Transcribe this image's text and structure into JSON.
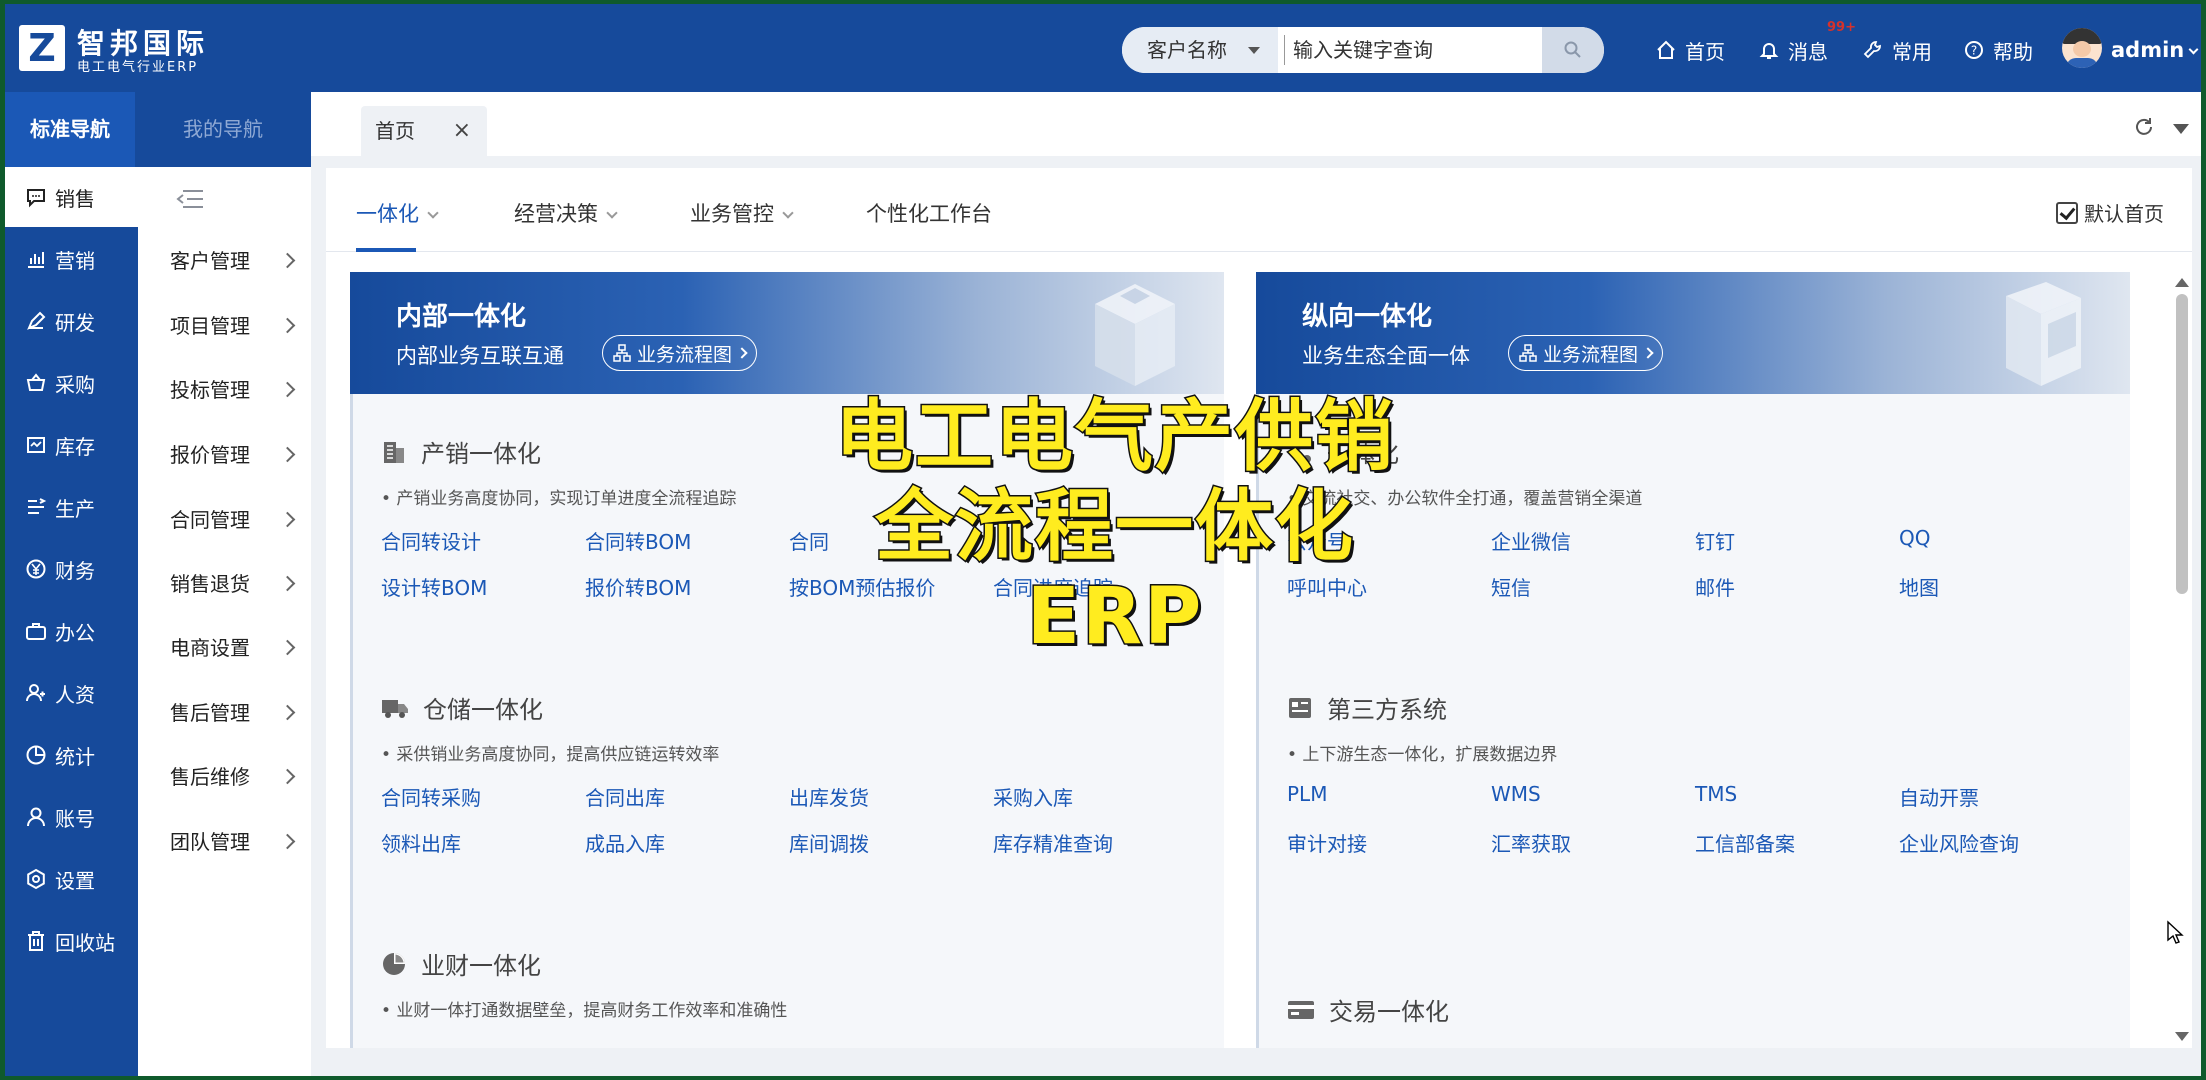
{
  "brand": {
    "name": "智邦国际",
    "subtitle": "电工电气行业ERP",
    "logo_letter": "Z"
  },
  "search": {
    "type": "客户名称",
    "placeholder": "输入关键字查询"
  },
  "topnav": {
    "home": "首页",
    "messages": "消息",
    "badge": "99+",
    "common": "常用",
    "help": "帮助",
    "user": "admin"
  },
  "nav_tabs": {
    "standard": "标准导航",
    "mine": "我的导航"
  },
  "leftnav": [
    {
      "label": "销售",
      "icon": "chat-icon"
    },
    {
      "label": "营销",
      "icon": "chart-icon"
    },
    {
      "label": "研发",
      "icon": "pen-icon"
    },
    {
      "label": "采购",
      "icon": "basket-icon"
    },
    {
      "label": "库存",
      "icon": "inventory-icon"
    },
    {
      "label": "生产",
      "icon": "production-icon"
    },
    {
      "label": "财务",
      "icon": "yen-icon"
    },
    {
      "label": "办公",
      "icon": "briefcase-icon"
    },
    {
      "label": "人资",
      "icon": "people-icon"
    },
    {
      "label": "统计",
      "icon": "pie-icon"
    },
    {
      "label": "账号",
      "icon": "user-icon"
    },
    {
      "label": "设置",
      "icon": "gear-icon"
    },
    {
      "label": "回收站",
      "icon": "trash-icon"
    }
  ],
  "submenu": [
    "客户管理",
    "项目管理",
    "投标管理",
    "报价管理",
    "合同管理",
    "销售退货",
    "电商设置",
    "售后管理",
    "售后维修",
    "团队管理"
  ],
  "doc_tab": {
    "label": "首页",
    "close": "×"
  },
  "section_tabs": [
    "一体化",
    "经营决策",
    "业务管控",
    "个性化工作台"
  ],
  "default_home": "默认首页",
  "cards": {
    "left": {
      "title": "内部一体化",
      "subtitle": "内部业务互联互通",
      "flow": "业务流程图",
      "groups": [
        {
          "title": "产销一体化",
          "desc": "• 产销业务高度协同，实现订单进度全流程追踪",
          "links": [
            "合同转设计",
            "合同转BOM",
            "合同",
            "设计转BOM",
            "报价转BOM",
            "按BOM预估报价",
            "合同进度追踪"
          ]
        },
        {
          "title": "仓储一体化",
          "desc": "• 采供销业务高度协同，提高供应链运转效率",
          "links": [
            "合同转采购",
            "合同出库",
            "出库发货",
            "采购入库",
            "领料出库",
            "成品入库",
            "库间调拨",
            "库存精准查询"
          ]
        },
        {
          "title": "业财一体化",
          "desc": "• 业财一体打通数据壁垒，提高财务工作效率和准确性"
        }
      ]
    },
    "right": {
      "title": "纵向一体化",
      "subtitle": "业务生态全面一体",
      "flow": "业务流程图",
      "groups": [
        {
          "title": "一体化",
          "desc": "• 交流社交、办公软件全打通，覆盖营销全渠道",
          "links": [
            "公众号",
            "企业微信",
            "钉钉",
            "QQ",
            "呼叫中心",
            "短信",
            "邮件",
            "地图"
          ]
        },
        {
          "title": "第三方系统",
          "desc": "• 上下游生态一体化，扩展数据边界",
          "links": [
            "PLM",
            "WMS",
            "TMS",
            "自动开票",
            "审计对接",
            "汇率获取",
            "工信部备案",
            "企业风险查询"
          ]
        },
        {
          "title": "交易一体化"
        }
      ]
    }
  },
  "overlay": {
    "line1": "电工电气产供销",
    "line2": "全流程一体化",
    "line3": "ERP"
  },
  "colors": {
    "primary": "#164a9b",
    "accent": "#1b58b6",
    "overlay_text": "#ffec1f"
  }
}
